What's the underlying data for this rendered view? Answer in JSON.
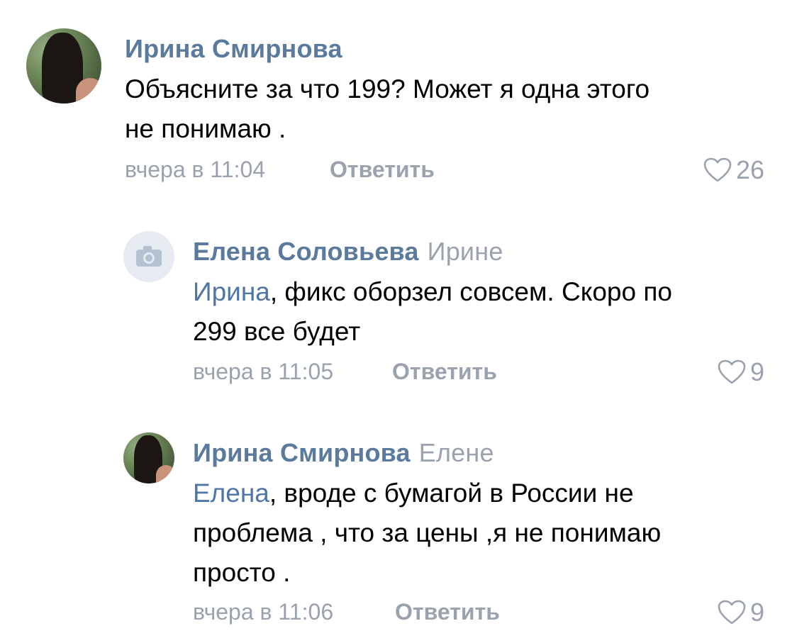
{
  "comments": [
    {
      "author": "Ирина Смирнова",
      "reply_to": "",
      "mention": "",
      "text": "Объясните за что 199? Может я одна этого",
      "text2": "не понимаю .",
      "time": "вчера в 11:04",
      "reply_label": "Ответить",
      "likes": "26",
      "avatar": "photo"
    },
    {
      "author": "Елена Соловьева",
      "reply_to": "Ирине",
      "mention": "Ирина",
      "text": ", фикс оборзел совсем. Скоро по",
      "text2": "299 все будет",
      "time": "вчера в 11:05",
      "reply_label": "Ответить",
      "likes": "9",
      "avatar": "camera-icon"
    },
    {
      "author": "Ирина Смирнова",
      "reply_to": "Елене",
      "mention": "Елена",
      "text": ", вроде с бумагой в России не",
      "text2": "проблема , что за цены ,я не понимаю",
      "text3": "просто .",
      "time": "вчера в 11:06",
      "reply_label": "Ответить",
      "likes": "9",
      "avatar": "photo"
    }
  ],
  "colors": {
    "author": "#5a7a9e",
    "mention": "#4f76a7",
    "muted": "#9aa3ad"
  }
}
